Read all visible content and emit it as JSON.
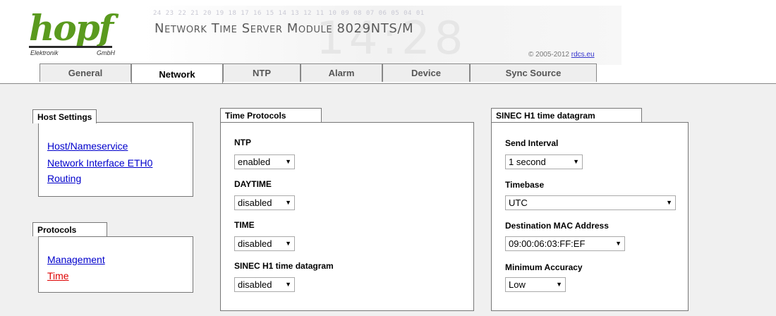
{
  "header": {
    "logo_text": "hopf",
    "logo_sub_left": "Elektronik",
    "logo_sub_right": "GmbH",
    "digits": "24 23 22 21 20 19 18 17 16 15 14 13 12 11 10 09 08 07 06 05 04 01",
    "clock": "14:28",
    "title": "Network Time Server Module 8029NTS/M",
    "copyright_prefix": "© 2005-2012 ",
    "copyright_link": "rdcs.eu",
    "brand_color": "#5a9a1e"
  },
  "tabs": [
    {
      "label": "General"
    },
    {
      "label": "Network"
    },
    {
      "label": "NTP"
    },
    {
      "label": "Alarm"
    },
    {
      "label": "Device"
    },
    {
      "label": "Sync Source"
    }
  ],
  "active_tab": "Network",
  "corner_icons": [
    "check-icon",
    "refresh-icon",
    "save-icon"
  ],
  "host_settings": {
    "title": "Host Settings",
    "links": [
      "Host/Nameservice",
      "Network Interface ETH0",
      "Routing"
    ]
  },
  "protocols": {
    "title": "Protocols",
    "links": [
      "Management",
      "Time"
    ],
    "active_link": "Time"
  },
  "time_protocols": {
    "title": "Time Protocols",
    "fields": [
      {
        "label": "NTP",
        "value": "enabled"
      },
      {
        "label": "DAYTIME",
        "value": "disabled"
      },
      {
        "label": "TIME",
        "value": "disabled"
      },
      {
        "label": "SINEC H1 time datagram",
        "value": "disabled"
      }
    ]
  },
  "sinec": {
    "title": "SINEC H1 time datagram",
    "fields": [
      {
        "label": "Send Interval",
        "value": "1 second"
      },
      {
        "label": "Timebase",
        "value": "UTC"
      },
      {
        "label": "Destination MAC Address",
        "value": "09:00:06:03:FF:EF"
      },
      {
        "label": "Minimum Accuracy",
        "value": "Low"
      }
    ]
  },
  "colors": {
    "link": "#0000cc",
    "active_link": "#dd0000",
    "content_bg": "#f0f0f0"
  }
}
